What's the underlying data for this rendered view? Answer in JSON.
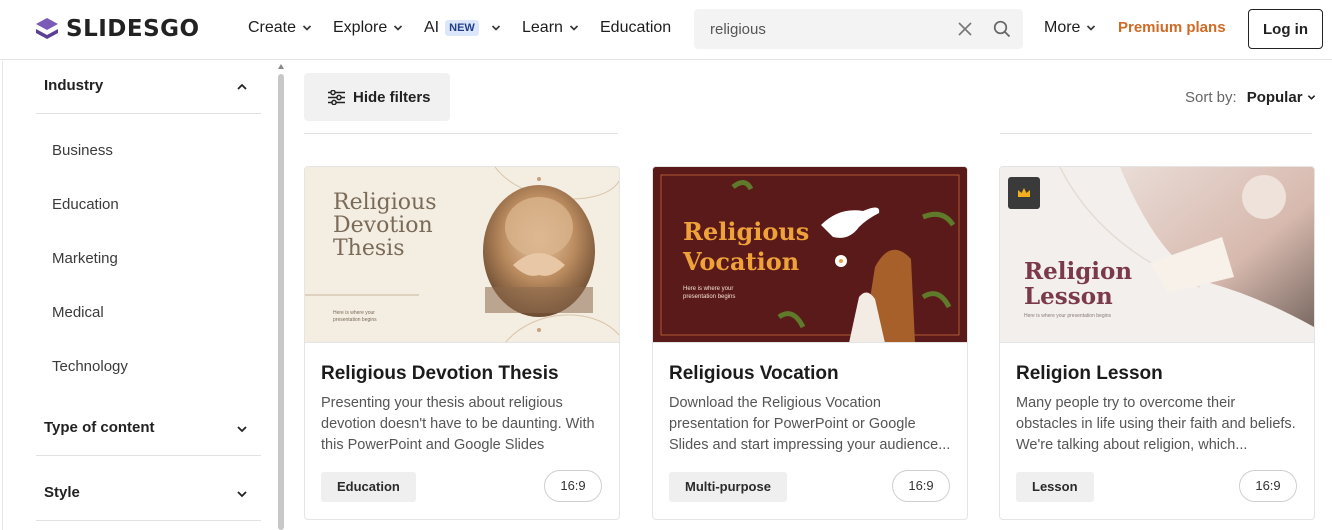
{
  "header": {
    "brand": "SLIDESGO",
    "nav": {
      "create": "Create",
      "explore": "Explore",
      "ai": "AI",
      "ai_badge": "NEW",
      "learn": "Learn",
      "education": "Education",
      "more": "More"
    },
    "search_value": "religious",
    "premium": "Premium plans",
    "login": "Log in"
  },
  "sidebar": {
    "industry": "Industry",
    "options": [
      "Business",
      "Education",
      "Marketing",
      "Medical",
      "Technology"
    ],
    "type_of_content": "Type of content",
    "style": "Style"
  },
  "toolbar": {
    "hide_filters": "Hide filters",
    "sort_label": "Sort by:",
    "sort_value": "Popular"
  },
  "cards": [
    {
      "title": "Religious Devotion Thesis",
      "description": "Presenting your thesis about religious devotion doesn't have to be daunting. With this PowerPoint and Google Slides template...",
      "tag": "Education",
      "ratio": "16:9",
      "thumb_title": "Religious Devotion Thesis",
      "thumb_sub": "Here is where your presentation begins"
    },
    {
      "title": "Religious Vocation",
      "description": "Download the Religious Vocation presentation for PowerPoint or Google Slides and start impressing your audience...",
      "tag": "Multi-purpose",
      "ratio": "16:9",
      "thumb_title_1": "Religious",
      "thumb_title_2": "Vocation",
      "thumb_sub": "Here is where your presentation begins"
    },
    {
      "title": "Religion Lesson",
      "description": "Many people try to overcome their obstacles in life using their faith and beliefs. We're talking about religion, which...",
      "tag": "Lesson",
      "ratio": "16:9",
      "thumb_title_1": "Religion",
      "thumb_title_2": "Lesson",
      "thumb_sub": "Here is where your presentation begins"
    }
  ],
  "colors": {
    "premium": "#d06a25",
    "vocation_bg": "#5a1a1a",
    "vocation_title": "#f0a23a",
    "lesson_title": "#7a3a4a"
  }
}
